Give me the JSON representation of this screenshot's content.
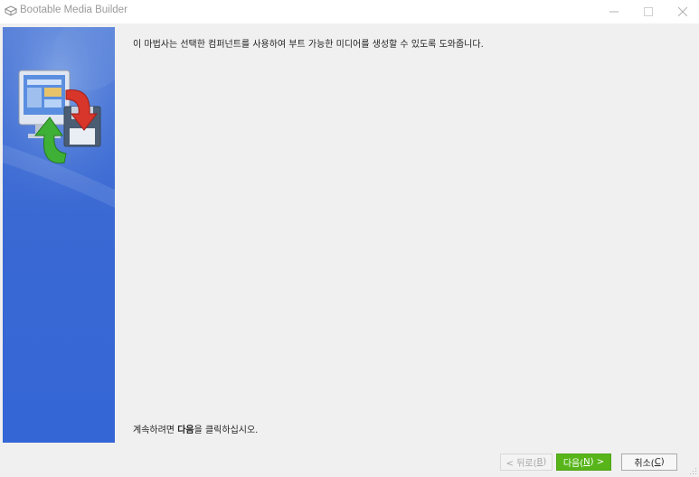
{
  "window": {
    "title": "Bootable Media Builder",
    "icon": "app-icon"
  },
  "content": {
    "intro": "이 마법사는 선택한 컴퍼넌트를 사용하여 부트 가능한 미디어를 생성할 수 있도록 도와줍니다.",
    "footer_before": "계속하려면 ",
    "footer_bold": "다음",
    "footer_after": "을 클릭하십시오."
  },
  "buttons": {
    "back_label": "< 뒤로(",
    "back_key": "B",
    "back_end": ")",
    "next_label": "다음(",
    "next_key": "N",
    "next_end": ") >",
    "cancel_label": "취소(",
    "cancel_key": "C",
    "cancel_end": ")"
  },
  "colors": {
    "side_panel": "#3a69d3",
    "next_button": "#57b51a"
  }
}
